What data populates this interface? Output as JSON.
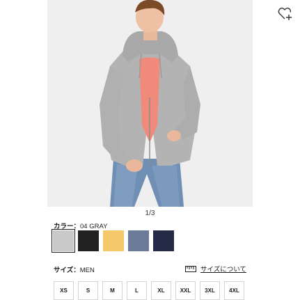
{
  "product": {
    "image_alt": "Gray zip-up hoodie worn over a pink t-shirt with blue jeans",
    "pager": "1/3",
    "wishlist_icon": "heart-plus-icon"
  },
  "color": {
    "label": "カラー：",
    "selected": "04 GRAY",
    "swatches": [
      {
        "name": "gray",
        "color": "#c9c9c9"
      },
      {
        "name": "black",
        "color": "#222222"
      },
      {
        "name": "yellow",
        "color": "#f5c96a"
      },
      {
        "name": "blue-gray",
        "color": "#6b7a99"
      },
      {
        "name": "navy",
        "color": "#232a45"
      }
    ]
  },
  "size": {
    "label": "サイズ：",
    "selected": "MEN",
    "guide_label": "サイズについて",
    "guide_icon": "ruler-icon",
    "options": [
      "XS",
      "S",
      "M",
      "L",
      "XL",
      "XXL",
      "3XL",
      "4XL"
    ]
  }
}
